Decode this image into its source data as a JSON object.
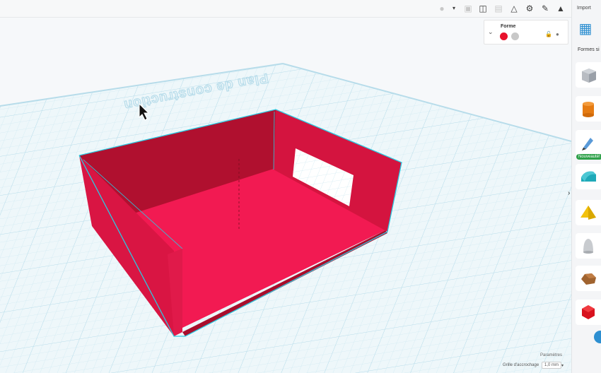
{
  "workplane": {
    "label": "Plan de construction"
  },
  "toolbar": {
    "icons": [
      "lightbulb-icon",
      "dropdown-arrow-icon",
      "group-icon",
      "ungroup-icon",
      "align-icon",
      "mirror-icon",
      "cruise-icon",
      "ruler-icon",
      "workplane-icon"
    ],
    "import_label": "Import"
  },
  "inspector": {
    "title": "Forme",
    "solid_color": "#e8122c",
    "hole_color": "#c8c8c8"
  },
  "sidebar": {
    "section_label": "Formes si",
    "new_badge": "Nouveauté!",
    "shapes": [
      "box-shape-icon",
      "cylinder-shape-icon",
      "scribble-shape-icon",
      "roof-shape-icon",
      "pyramid-shape-icon",
      "paraboloid-shape-icon",
      "rock-shape-icon",
      "polyhedron-shape-icon"
    ]
  },
  "footer": {
    "settings_label": "Paramètres",
    "snap_label": "Grille d'accrochage",
    "snap_value": "1,0 mm"
  },
  "colors": {
    "object_red": "#e8174a",
    "object_dark": "#b0102f",
    "outline": "#2cc9e0",
    "grid": "#cfe9f2",
    "accent": "#2d8fd1"
  }
}
